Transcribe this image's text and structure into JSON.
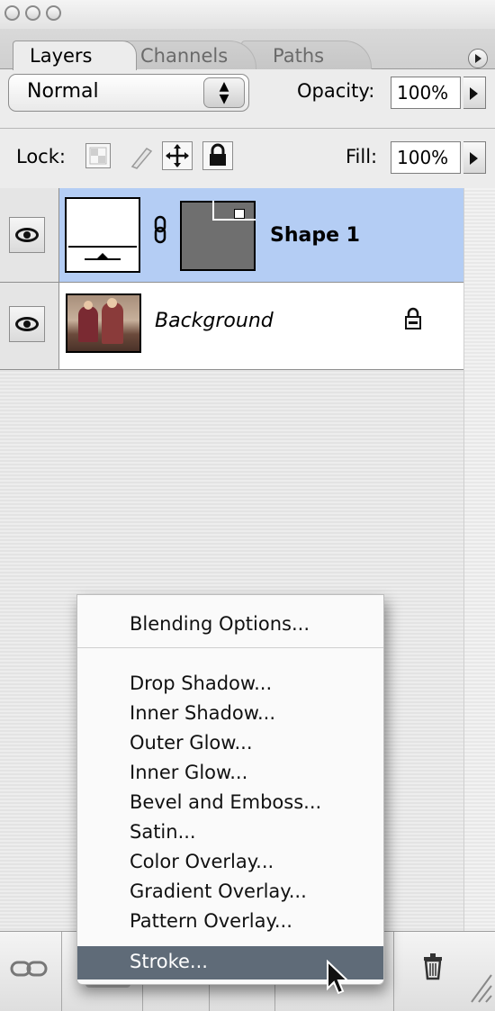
{
  "tabs": [
    {
      "label": "Layers"
    },
    {
      "label": "Channels"
    },
    {
      "label": "Paths"
    }
  ],
  "blend_mode": {
    "value": "Normal",
    "stepper": "▲▼"
  },
  "opacity": {
    "label": "Opacity:",
    "value": "100%"
  },
  "lock": {
    "label": "Lock:"
  },
  "fill": {
    "label": "Fill:",
    "value": "100%"
  },
  "layers": [
    {
      "name": "Shape 1",
      "selected": true
    },
    {
      "name": "Background",
      "locked": true
    }
  ],
  "context_menu": {
    "top_item": "Blending Options...",
    "items": [
      "Drop Shadow...",
      "Inner Shadow...",
      "Outer Glow...",
      "Inner Glow...",
      "Bevel and Emboss...",
      "Satin...",
      "Color Overlay...",
      "Gradient Overlay...",
      "Pattern Overlay...",
      "Stroke..."
    ],
    "highlighted": "Stroke..."
  },
  "colors": {
    "selection": "#b4cdf4",
    "menu_highlight": "#5f6b78"
  }
}
